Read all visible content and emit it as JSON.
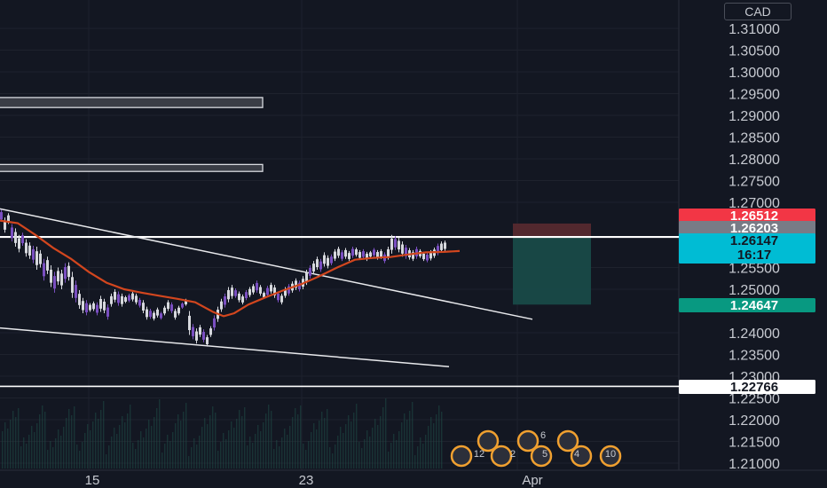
{
  "currency_button": "CAD",
  "chart_data": {
    "type": "candlestick",
    "symbol_quote": "CAD",
    "y_axis": {
      "ticks": [
        "1.31000",
        "1.30500",
        "1.30000",
        "1.29500",
        "1.29000",
        "1.28500",
        "1.28000",
        "1.27500",
        "1.27000",
        "1.25500",
        "1.25000",
        "1.24000",
        "1.23500",
        "1.23000",
        "1.22500",
        "1.22000",
        "1.21500",
        "1.21000"
      ],
      "ylim": [
        1.208,
        1.316
      ]
    },
    "x_axis": {
      "ticks": [
        "15",
        "23",
        "Apr"
      ]
    },
    "price_tags": [
      {
        "value": "1.26512",
        "color": "#f23645",
        "text_color": "#ffffff"
      },
      {
        "value": "1.26203",
        "color": "#787b86",
        "text_color": "#ffffff"
      },
      {
        "value": "1.26147",
        "color": "#00bcd4",
        "text_color": "#131722",
        "countdown": "16:17"
      },
      {
        "value": "1.24647",
        "color": "#089981",
        "text_color": "#ffffff"
      },
      {
        "value": "1.22766",
        "color": "#ffffff",
        "text_color": "#131722"
      }
    ],
    "horizontal_lines": [
      1.26203,
      1.22766
    ],
    "trendlines": [
      {
        "from": [
          0,
          1.2685
        ],
        "to": [
          600,
          1.2431
        ]
      },
      {
        "from": [
          0,
          1.2411
        ],
        "to": [
          506,
          1.2322
        ]
      }
    ],
    "zones": [
      {
        "y_top": 1.2941,
        "y_bottom": 1.2918
      },
      {
        "y_top": 1.2787,
        "y_bottom": 1.2771
      }
    ],
    "position": {
      "entry": 1.26203,
      "stop": 1.26512,
      "target": 1.24647
    },
    "candles": [
      [
        0,
        1.2683,
        1.2655
      ],
      [
        4,
        1.2665,
        1.263
      ],
      [
        8,
        1.2675,
        1.265
      ],
      [
        12,
        1.265,
        1.261
      ],
      [
        16,
        1.264,
        1.2598
      ],
      [
        20,
        1.2625,
        1.2585
      ],
      [
        24,
        1.263,
        1.26
      ],
      [
        28,
        1.2615,
        1.2575
      ],
      [
        32,
        1.2608,
        1.257
      ],
      [
        36,
        1.26,
        1.256
      ],
      [
        40,
        1.2598,
        1.2545
      ],
      [
        44,
        1.259,
        1.255
      ],
      [
        48,
        1.257,
        1.252
      ],
      [
        52,
        1.2575,
        1.2535
      ],
      [
        56,
        1.2555,
        1.2505
      ],
      [
        60,
        1.254,
        1.2492
      ],
      [
        64,
        1.255,
        1.251
      ],
      [
        68,
        1.2545,
        1.25
      ],
      [
        72,
        1.256,
        1.2515
      ],
      [
        76,
        1.2562,
        1.252
      ],
      [
        80,
        1.254,
        1.248
      ],
      [
        84,
        1.252,
        1.247
      ],
      [
        88,
        1.2498,
        1.2455
      ],
      [
        92,
        1.248,
        1.2445
      ],
      [
        96,
        1.2475,
        1.244
      ],
      [
        100,
        1.2468,
        1.2448
      ],
      [
        104,
        1.2472,
        1.245
      ],
      [
        108,
        1.247,
        1.244
      ],
      [
        112,
        1.2485,
        1.2448
      ],
      [
        116,
        1.2478,
        1.2445
      ],
      [
        120,
        1.2465,
        1.243
      ],
      [
        124,
        1.249,
        1.246
      ],
      [
        128,
        1.25,
        1.247
      ],
      [
        132,
        1.2495,
        1.2462
      ],
      [
        136,
        1.249,
        1.246
      ],
      [
        140,
        1.2485,
        1.2468
      ],
      [
        144,
        1.249,
        1.247
      ],
      [
        148,
        1.2495,
        1.2472
      ],
      [
        152,
        1.249,
        1.2465
      ],
      [
        156,
        1.248,
        1.2458
      ],
      [
        160,
        1.2475,
        1.2445
      ],
      [
        164,
        1.246,
        1.243
      ],
      [
        168,
        1.2455,
        1.2432
      ],
      [
        172,
        1.245,
        1.2428
      ],
      [
        176,
        1.2458,
        1.2435
      ],
      [
        180,
        1.2448,
        1.243
      ],
      [
        184,
        1.2462,
        1.244
      ],
      [
        188,
        1.2475,
        1.245
      ],
      [
        192,
        1.247,
        1.2445
      ],
      [
        196,
        1.2455,
        1.243
      ],
      [
        200,
        1.2462,
        1.244
      ],
      [
        204,
        1.247,
        1.2455
      ],
      [
        208,
        1.2478,
        1.2462
      ],
      [
        212,
        1.245,
        1.2395
      ],
      [
        216,
        1.242,
        1.2385
      ],
      [
        220,
        1.241,
        1.2375
      ],
      [
        224,
        1.2418,
        1.239
      ],
      [
        228,
        1.2408,
        1.2378
      ],
      [
        232,
        1.2395,
        1.2368
      ],
      [
        236,
        1.2415,
        1.239
      ],
      [
        240,
        1.244,
        1.2405
      ],
      [
        244,
        1.246,
        1.2425
      ],
      [
        248,
        1.2478,
        1.2448
      ],
      [
        252,
        1.249,
        1.2458
      ],
      [
        256,
        1.2505,
        1.247
      ],
      [
        260,
        1.251,
        1.2478
      ],
      [
        264,
        1.2502,
        1.248
      ],
      [
        268,
        1.2495,
        1.247
      ],
      [
        272,
        1.2488,
        1.2465
      ],
      [
        276,
        1.2498,
        1.2475
      ],
      [
        280,
        1.2505,
        1.2482
      ],
      [
        284,
        1.2512,
        1.2488
      ],
      [
        288,
        1.252,
        1.2492
      ],
      [
        292,
        1.251,
        1.2485
      ],
      [
        296,
        1.2495,
        1.2478
      ],
      [
        300,
        1.2508,
        1.2482
      ],
      [
        304,
        1.2515,
        1.249
      ],
      [
        308,
        1.251,
        1.248
      ],
      [
        312,
        1.2495,
        1.247
      ],
      [
        316,
        1.249,
        1.2465
      ],
      [
        320,
        1.2505,
        1.248
      ],
      [
        324,
        1.2512,
        1.2485
      ],
      [
        328,
        1.2518,
        1.2492
      ],
      [
        332,
        1.2525,
        1.2498
      ],
      [
        336,
        1.252,
        1.2495
      ],
      [
        340,
        1.253,
        1.25
      ],
      [
        344,
        1.2545,
        1.251
      ],
      [
        348,
        1.2555,
        1.2525
      ],
      [
        352,
        1.2565,
        1.2535
      ],
      [
        356,
        1.2575,
        1.2545
      ],
      [
        360,
        1.257,
        1.254
      ],
      [
        364,
        1.2585,
        1.2552
      ],
      [
        368,
        1.2578,
        1.2548
      ],
      [
        372,
        1.258,
        1.2555
      ],
      [
        376,
        1.2592,
        1.2565
      ],
      [
        380,
        1.2598,
        1.2572
      ],
      [
        384,
        1.259,
        1.2565
      ],
      [
        388,
        1.2595,
        1.257
      ],
      [
        392,
        1.2588,
        1.2565
      ],
      [
        396,
        1.2598,
        1.2572
      ],
      [
        400,
        1.2596,
        1.2575
      ],
      [
        404,
        1.259,
        1.2568
      ],
      [
        408,
        1.2592,
        1.257
      ],
      [
        412,
        1.2586,
        1.2565
      ],
      [
        416,
        1.2588,
        1.2572
      ],
      [
        420,
        1.2595,
        1.2574
      ],
      [
        424,
        1.259,
        1.2568
      ],
      [
        428,
        1.2592,
        1.257
      ],
      [
        432,
        1.2585,
        1.256
      ],
      [
        436,
        1.2598,
        1.2568
      ],
      [
        440,
        1.2625,
        1.2582
      ],
      [
        444,
        1.2622,
        1.259
      ],
      [
        448,
        1.2618,
        1.2585
      ],
      [
        452,
        1.261,
        1.2575
      ],
      [
        456,
        1.2602,
        1.257
      ],
      [
        460,
        1.2595,
        1.2568
      ],
      [
        464,
        1.259,
        1.2565
      ],
      [
        468,
        1.2598,
        1.257
      ],
      [
        472,
        1.2592,
        1.2572
      ],
      [
        476,
        1.2586,
        1.2565
      ],
      [
        480,
        1.2584,
        1.2562
      ],
      [
        484,
        1.259,
        1.2566
      ],
      [
        488,
        1.2596,
        1.2572
      ],
      [
        492,
        1.2605,
        1.2578
      ],
      [
        496,
        1.261,
        1.2585
      ],
      [
        500,
        1.2612,
        1.2588
      ]
    ],
    "moving_average": [
      [
        0,
        1.2658
      ],
      [
        20,
        1.2652
      ],
      [
        40,
        1.2625
      ],
      [
        60,
        1.2595
      ],
      [
        80,
        1.257
      ],
      [
        100,
        1.254
      ],
      [
        120,
        1.2515
      ],
      [
        140,
        1.25
      ],
      [
        160,
        1.2492
      ],
      [
        180,
        1.2485
      ],
      [
        200,
        1.2478
      ],
      [
        220,
        1.247
      ],
      [
        240,
        1.2448
      ],
      [
        252,
        1.2438
      ],
      [
        264,
        1.2445
      ],
      [
        280,
        1.2465
      ],
      [
        300,
        1.2482
      ],
      [
        320,
        1.2498
      ],
      [
        340,
        1.2512
      ],
      [
        360,
        1.253
      ],
      [
        380,
        1.255
      ],
      [
        400,
        1.2568
      ],
      [
        420,
        1.2572
      ],
      [
        440,
        1.2574
      ],
      [
        460,
        1.258
      ],
      [
        480,
        1.2585
      ],
      [
        500,
        1.2586
      ],
      [
        518,
        1.2588
      ]
    ],
    "calendar_events": [
      "6",
      "12",
      "2",
      "5",
      "4",
      "10"
    ]
  }
}
